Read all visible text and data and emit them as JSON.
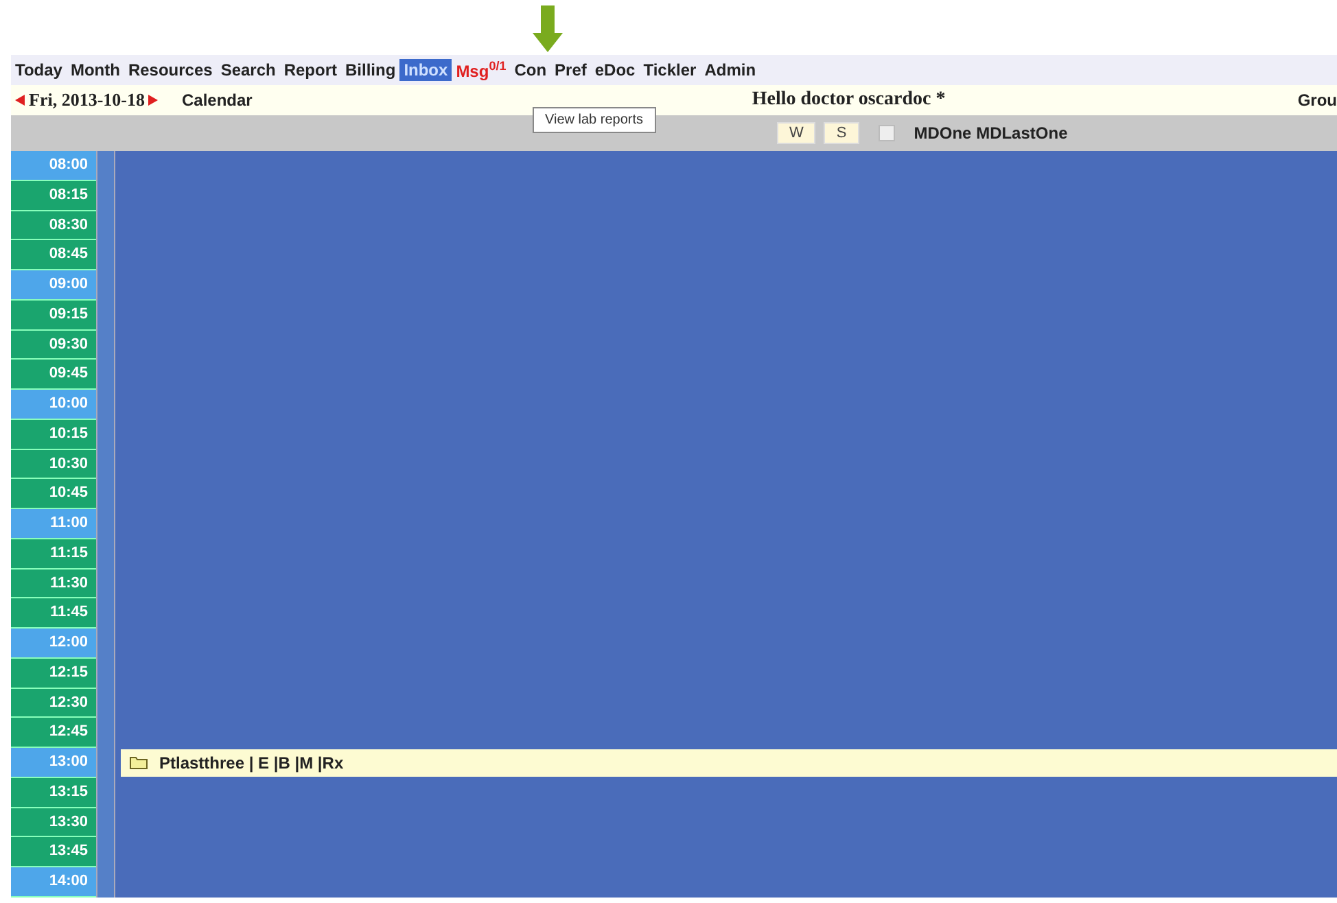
{
  "menu": [
    {
      "label": "Today",
      "selected": false
    },
    {
      "label": "Month",
      "selected": false
    },
    {
      "label": "Resources",
      "selected": false
    },
    {
      "label": "Search",
      "selected": false
    },
    {
      "label": "Report",
      "selected": false
    },
    {
      "label": "Billing",
      "selected": false
    },
    {
      "label": "Inbox",
      "selected": true
    },
    {
      "label": "Msg$^{0/1}$",
      "selected": false,
      "kind": "alert"
    },
    {
      "label": "Con",
      "selected": false
    },
    {
      "label": "Pref",
      "selected": false
    },
    {
      "label": "eDoc",
      "selected": false
    },
    {
      "label": "Tickler",
      "selected": false
    },
    {
      "label": "Admin",
      "selected": false
    }
  ],
  "tooltip": "View lab reports",
  "date": "Fri, 2013-10-18",
  "calendar_link": "Calendar",
  "greeting": "Hello doctor oscardoc *",
  "group_label": "Grou",
  "view_buttons": [
    "W",
    "S"
  ],
  "provider": {
    "name": "MDOne MDLastOne",
    "checked": false
  },
  "slots": [
    {
      "time": "08:00",
      "kind": "hour"
    },
    {
      "time": "08:15",
      "kind": "quarter"
    },
    {
      "time": "08:30",
      "kind": "quarter"
    },
    {
      "time": "08:45",
      "kind": "quarter"
    },
    {
      "time": "09:00",
      "kind": "hour"
    },
    {
      "time": "09:15",
      "kind": "quarter"
    },
    {
      "time": "09:30",
      "kind": "quarter"
    },
    {
      "time": "09:45",
      "kind": "quarter"
    },
    {
      "time": "10:00",
      "kind": "hour"
    },
    {
      "time": "10:15",
      "kind": "quarter"
    },
    {
      "time": "10:30",
      "kind": "quarter"
    },
    {
      "time": "10:45",
      "kind": "quarter"
    },
    {
      "time": "11:00",
      "kind": "hour"
    },
    {
      "time": "11:15",
      "kind": "quarter"
    },
    {
      "time": "11:30",
      "kind": "quarter"
    },
    {
      "time": "11:45",
      "kind": "quarter"
    },
    {
      "time": "12:00",
      "kind": "hour"
    },
    {
      "time": "12:15",
      "kind": "quarter"
    },
    {
      "time": "12:30",
      "kind": "quarter"
    },
    {
      "time": "12:45",
      "kind": "quarter"
    },
    {
      "time": "13:00",
      "kind": "hour",
      "appointment": "Ptlastthree | E |B |M |Rx"
    },
    {
      "time": "13:15",
      "kind": "quarter"
    },
    {
      "time": "13:30",
      "kind": "quarter"
    },
    {
      "time": "13:45",
      "kind": "quarter"
    },
    {
      "time": "14:00",
      "kind": "hour"
    }
  ]
}
